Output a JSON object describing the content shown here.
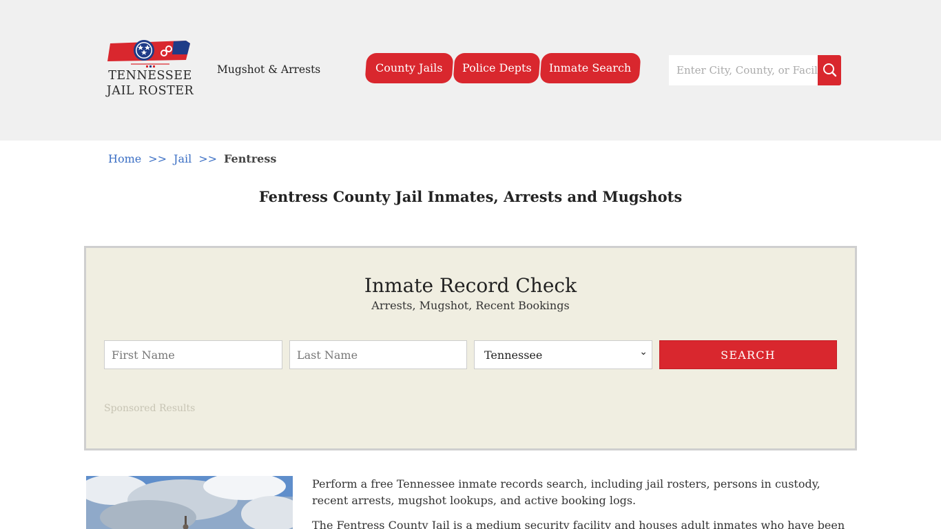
{
  "header": {
    "logo": {
      "line1": "TENNESSEE",
      "line2": "JAIL ROSTER",
      "icon": "tennessee-state-flag-icon"
    },
    "tagline": "Mugshot & Arrests",
    "nav": [
      {
        "label": "County Jails"
      },
      {
        "label": "Police Depts"
      },
      {
        "label": "Inmate Search"
      }
    ],
    "search": {
      "placeholder": "Enter City, County, or Facility",
      "icon": "search-icon"
    }
  },
  "breadcrumb": {
    "home": "Home",
    "separator": ">>",
    "jail": "Jail",
    "current": "Fentress"
  },
  "page_title": "Fentress County Jail Inmates, Arrests and Mugshots",
  "record_check": {
    "title": "Inmate Record Check",
    "subtitle": "Arrests, Mugshot, Recent Bookings",
    "first_name_placeholder": "First Name",
    "last_name_placeholder": "Last Name",
    "state_selected": "Tennessee",
    "search_label": "SEARCH",
    "sponsored": "Sponsored Results"
  },
  "content": {
    "paragraph1": "Perform a free Tennessee inmate records search, including jail rosters, persons in custody, recent arrests, mugshot lookups, and active booking logs.",
    "paragraph2": "The Fentress County Jail is a medium security facility and houses adult inmates who have been"
  },
  "colors": {
    "accent_red": "#d9272e",
    "header_bg": "#f0f0f0",
    "panel_bg": "#f0eee1",
    "link_blue": "#3b6fc4",
    "flag_blue": "#1f3c88"
  }
}
